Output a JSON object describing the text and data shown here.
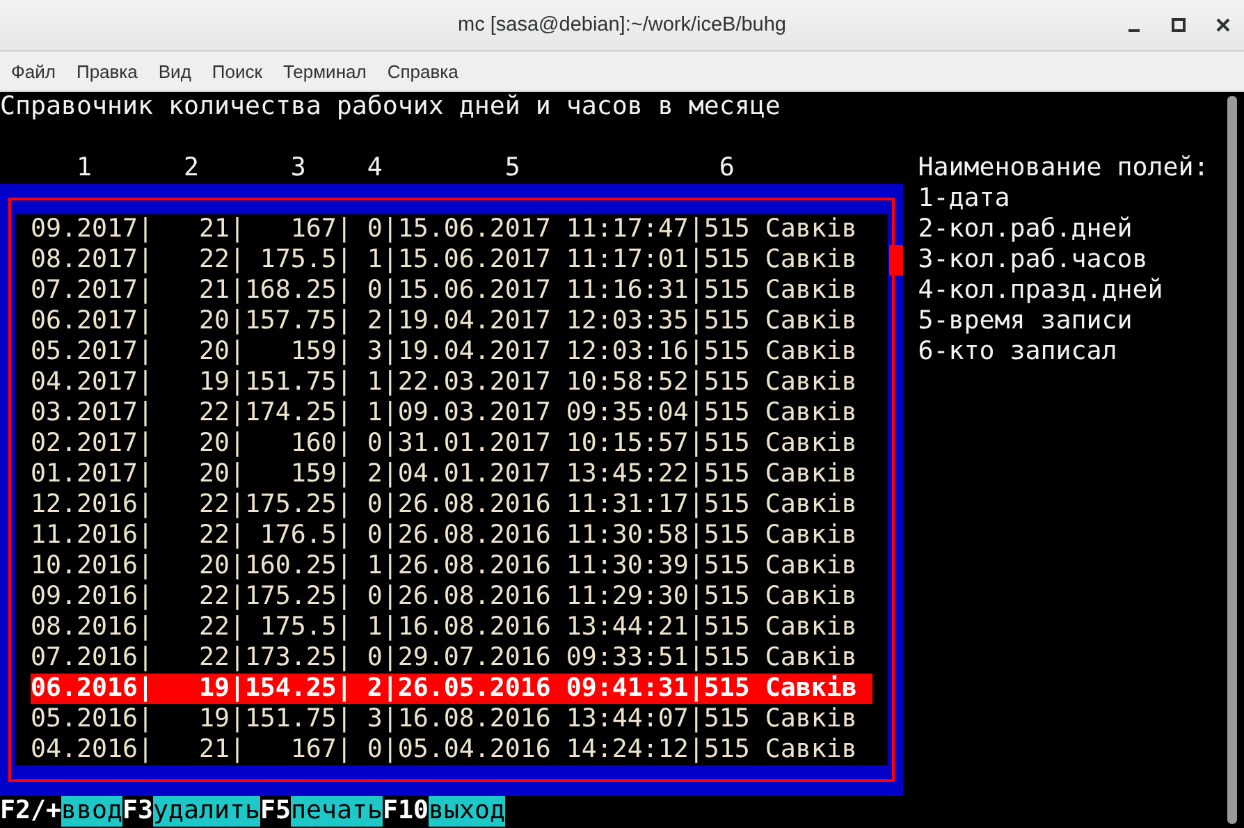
{
  "window": {
    "title": "mc [sasa@debian]:~/work/iceB/buhg"
  },
  "menu": [
    "Файл",
    "Правка",
    "Вид",
    "Поиск",
    "Терминал",
    "Справка"
  ],
  "heading": "Справочник количества рабочих дней и часов в месяце",
  "column_numbers": [
    "1",
    "2",
    "3",
    "4",
    "5",
    "6"
  ],
  "rows": [
    {
      "text": "09.2017|   21|   167| 0|15.06.2017 11:17:47|515 Савків",
      "selected": false
    },
    {
      "text": "08.2017|   22| 175.5| 1|15.06.2017 11:17:01|515 Савків",
      "selected": false
    },
    {
      "text": "07.2017|   21|168.25| 0|15.06.2017 11:16:31|515 Савків",
      "selected": false
    },
    {
      "text": "06.2017|   20|157.75| 2|19.04.2017 12:03:35|515 Савків",
      "selected": false
    },
    {
      "text": "05.2017|   20|   159| 3|19.04.2017 12:03:16|515 Савків",
      "selected": false
    },
    {
      "text": "04.2017|   19|151.75| 1|22.03.2017 10:58:52|515 Савків",
      "selected": false
    },
    {
      "text": "03.2017|   22|174.25| 1|09.03.2017 09:35:04|515 Савків",
      "selected": false
    },
    {
      "text": "02.2017|   20|   160| 0|31.01.2017 10:15:57|515 Савків",
      "selected": false
    },
    {
      "text": "01.2017|   20|   159| 2|04.01.2017 13:45:22|515 Савків",
      "selected": false
    },
    {
      "text": "12.2016|   22|175.25| 0|26.08.2016 11:31:17|515 Савків",
      "selected": false
    },
    {
      "text": "11.2016|   22| 176.5| 0|26.08.2016 11:30:58|515 Савків",
      "selected": false
    },
    {
      "text": "10.2016|   20|160.25| 1|26.08.2016 11:30:39|515 Савків",
      "selected": false
    },
    {
      "text": "09.2016|   22|175.25| 0|26.08.2016 11:29:30|515 Савків",
      "selected": false
    },
    {
      "text": "08.2016|   22| 175.5| 1|16.08.2016 13:44:21|515 Савків",
      "selected": false
    },
    {
      "text": "07.2016|   22|173.25| 0|29.07.2016 09:33:51|515 Савків",
      "selected": false
    },
    {
      "text": "06.2016|   19|154.25| 2|26.05.2016 09:41:31|515 Савків",
      "selected": true
    },
    {
      "text": "05.2016|   19|151.75| 3|16.08.2016 13:44:07|515 Савків",
      "selected": false
    },
    {
      "text": "04.2016|   21|   167| 0|05.04.2016 14:24:12|515 Савків",
      "selected": false
    }
  ],
  "legend": {
    "title": "Наименование полей:",
    "items": [
      "1-дата",
      "2-кол.раб.дней",
      "3-кол.раб.часов",
      "4-кол.празд.дней",
      "5-время записи",
      "6-кто записал"
    ]
  },
  "function_keys": [
    {
      "key": "F2/+",
      "label": "ввод"
    },
    {
      "key": "F3",
      "label": "удалить"
    },
    {
      "key": "F5",
      "label": "печать"
    },
    {
      "key": "F10",
      "label": "выход"
    }
  ]
}
